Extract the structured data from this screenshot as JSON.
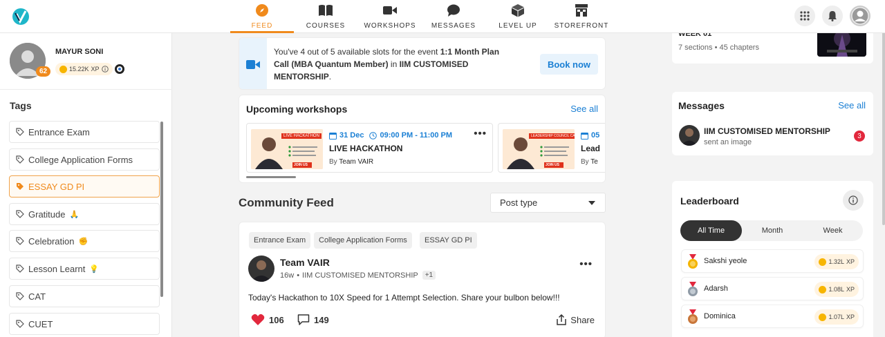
{
  "nav": {
    "items": [
      {
        "label": "FEED",
        "icon": "compass-icon"
      },
      {
        "label": "COURSES",
        "icon": "book-icon"
      },
      {
        "label": "WORKSHOPS",
        "icon": "video-camera-icon"
      },
      {
        "label": "MESSAGES",
        "icon": "chat-bubble-icon"
      },
      {
        "label": "LEVEL UP",
        "icon": "cube-icon"
      },
      {
        "label": "STOREFRONT",
        "icon": "storefront-icon"
      }
    ],
    "accent": "#f08a1c"
  },
  "profile": {
    "name": "MAYUR SONI",
    "level": "62",
    "xp": "15.22K",
    "xp_unit": "XP"
  },
  "tags": {
    "title": "Tags",
    "items": [
      {
        "label": "Entrance Exam",
        "emoji": ""
      },
      {
        "label": "College Application Forms",
        "emoji": ""
      },
      {
        "label": "ESSAY GD PI",
        "emoji": ""
      },
      {
        "label": "Gratitude",
        "emoji": "🙏"
      },
      {
        "label": "Celebration",
        "emoji": "✊"
      },
      {
        "label": "Lesson Learnt",
        "emoji": "💡"
      },
      {
        "label": "CAT",
        "emoji": ""
      },
      {
        "label": "CUET",
        "emoji": ""
      }
    ]
  },
  "slot_banner": {
    "text_pre": "You've 4 out of 5 available slots for the event ",
    "event": "1:1 Month Plan Call (MBA Quantum Member)",
    "text_mid": " in ",
    "org": "IIM CUSTOMISED MENTORSHIP",
    "text_post": ".",
    "button": "Book now"
  },
  "workshops": {
    "title": "Upcoming workshops",
    "see_all": "See all",
    "items": [
      {
        "date": "31 Dec",
        "time": "09:00 PM - 11:00 PM",
        "title": "LIVE HACKATHON",
        "by": "By",
        "host": "Team VAIR",
        "thumb_banner": "LIVE HACKATHON",
        "thumb_cta": "JOIN US"
      },
      {
        "date": "05",
        "time": "",
        "title": "Lead",
        "by": "By",
        "host": "Te",
        "thumb_banner": "LEADERSHIP COUNCIL CALL",
        "thumb_cta": "JOIN US"
      }
    ]
  },
  "feed": {
    "title": "Community Feed",
    "post_type_label": "Post type"
  },
  "post": {
    "tags": [
      "Entrance Exam",
      "College Application Forms",
      "ESSAY GD PI"
    ],
    "author": "Team VAIR",
    "age": "16w",
    "community": "IIM CUSTOMISED MENTORSHIP",
    "extra": "+1",
    "body": "Today's Hackathon to 10X Speed for 1 Attempt Selection. Share your bulbon below!!!",
    "likes": "106",
    "comments": "149",
    "share_label": "Share"
  },
  "course": {
    "title": "WEEK 01",
    "meta": "7 sections • 45 chapters"
  },
  "messages": {
    "title": "Messages",
    "see_all": "See all",
    "items": [
      {
        "name": "IIM CUSTOMISED MENTORSHIP",
        "preview": "sent an image",
        "unread": "3"
      }
    ]
  },
  "leaderboard": {
    "title": "Leaderboard",
    "tabs": [
      "All Time",
      "Month",
      "Week"
    ],
    "active_tab": "All Time",
    "rows": [
      {
        "name": "Sakshi yeole",
        "xp": "1.32L",
        "unit": "XP",
        "medal": "gold"
      },
      {
        "name": "Adarsh",
        "xp": "1.08L",
        "unit": "XP",
        "medal": "silver"
      },
      {
        "name": "Dominica",
        "xp": "1.07L",
        "unit": "XP",
        "medal": "bronze"
      }
    ]
  }
}
